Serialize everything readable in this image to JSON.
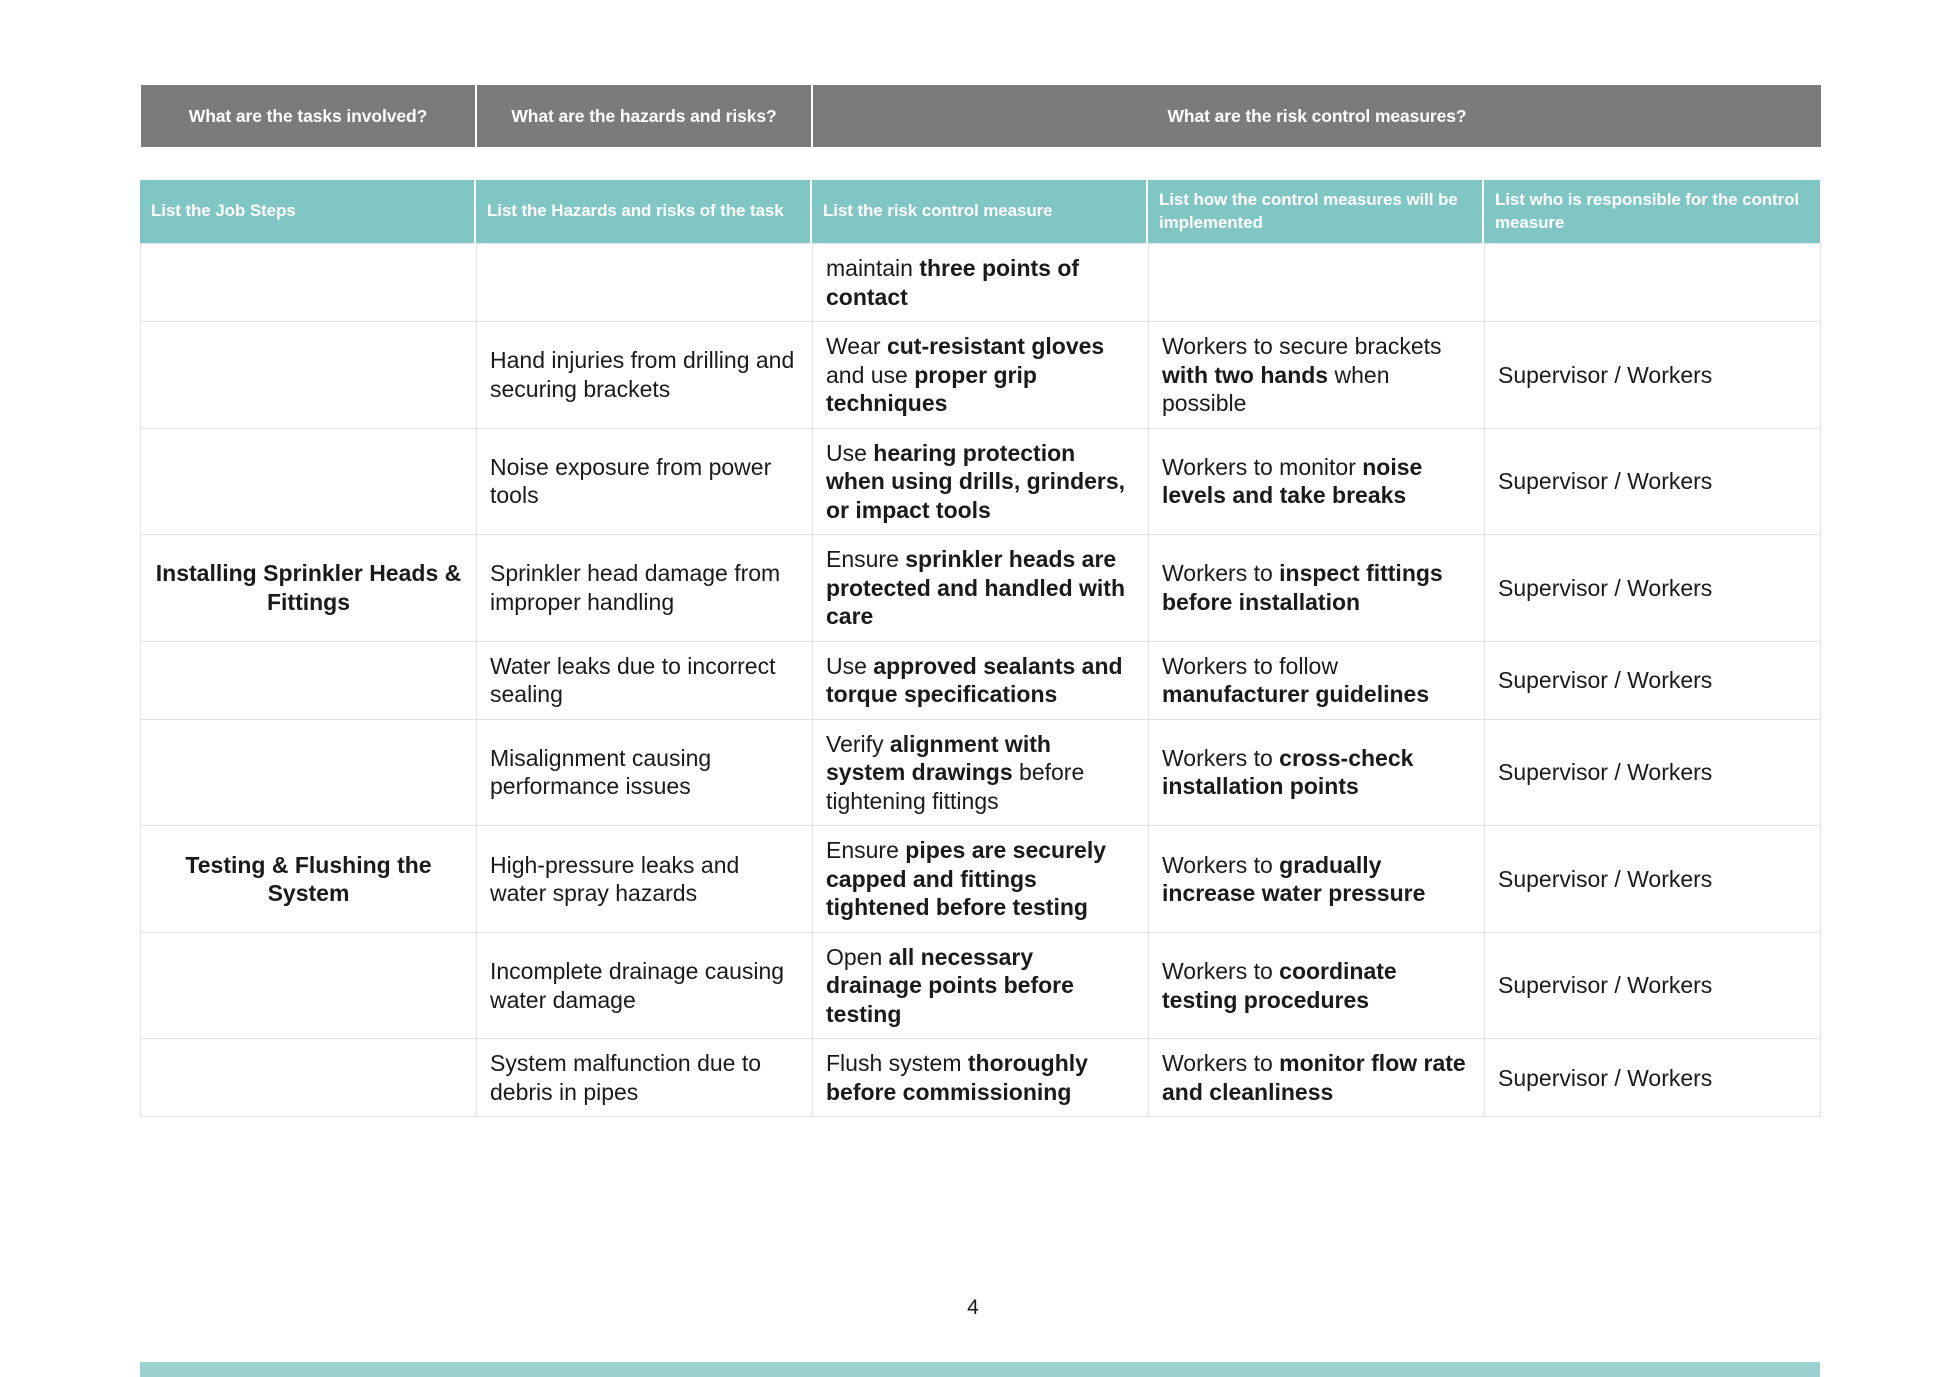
{
  "document": {
    "page_number": "4"
  },
  "top_header": {
    "tasks": "What are the tasks involved?",
    "hazards": "What are the hazards and risks?",
    "controls": "What are the risk control measures?"
  },
  "sub_header": {
    "col0": "List the Job Steps",
    "col1": "List the Hazards and risks of the task",
    "col2": "List the risk control measure",
    "col3": "List how the control measures will be implemented",
    "col4": "List who is responsible for the control measure"
  },
  "colors": {
    "top_header_bg": "#7b7b7b",
    "sub_header_bg": "#7fc6c4",
    "bottom_bar": "#9bd1d0",
    "grid_line": "#e2e2e2",
    "text": "#1a1a1a"
  },
  "rows": [
    {
      "step": "",
      "hazard": "",
      "control_runs": [
        {
          "text": "maintain ",
          "bold": false
        },
        {
          "text": "three points of contact",
          "bold": true
        }
      ],
      "implementation_runs": [],
      "responsible": ""
    },
    {
      "step": "",
      "hazard": "Hand injuries from drilling and securing brackets",
      "control_runs": [
        {
          "text": "Wear ",
          "bold": false
        },
        {
          "text": "cut-resistant gloves",
          "bold": true
        },
        {
          "text": " and use ",
          "bold": false
        },
        {
          "text": "proper grip techniques",
          "bold": true
        }
      ],
      "implementation_runs": [
        {
          "text": "Workers to secure brackets ",
          "bold": false
        },
        {
          "text": "with two hands",
          "bold": true
        },
        {
          "text": " when possible",
          "bold": false
        }
      ],
      "responsible": "Supervisor / Workers"
    },
    {
      "step": "",
      "hazard": "Noise exposure from power tools",
      "control_runs": [
        {
          "text": "Use ",
          "bold": false
        },
        {
          "text": "hearing protection when using drills, grinders, or impact tools",
          "bold": true
        }
      ],
      "implementation_runs": [
        {
          "text": "Workers to monitor ",
          "bold": false
        },
        {
          "text": "noise levels and take breaks",
          "bold": true
        }
      ],
      "responsible": "Supervisor / Workers"
    },
    {
      "step": "Installing Sprinkler Heads & Fittings",
      "hazard": "Sprinkler head damage from improper handling",
      "control_runs": [
        {
          "text": "Ensure ",
          "bold": false
        },
        {
          "text": "sprinkler heads are protected and handled with care",
          "bold": true
        }
      ],
      "implementation_runs": [
        {
          "text": "Workers to ",
          "bold": false
        },
        {
          "text": "inspect fittings before installation",
          "bold": true
        }
      ],
      "responsible": "Supervisor / Workers"
    },
    {
      "step": "",
      "hazard": "Water leaks due to incorrect sealing",
      "control_runs": [
        {
          "text": "Use ",
          "bold": false
        },
        {
          "text": "approved sealants and torque specifications",
          "bold": true
        }
      ],
      "implementation_runs": [
        {
          "text": "Workers to follow ",
          "bold": false
        },
        {
          "text": "manufacturer guidelines",
          "bold": true
        }
      ],
      "responsible": "Supervisor / Workers"
    },
    {
      "step": "",
      "hazard": "Misalignment causing performance issues",
      "control_runs": [
        {
          "text": "Verify ",
          "bold": false
        },
        {
          "text": "alignment with system drawings",
          "bold": true
        },
        {
          "text": " before tightening fittings",
          "bold": false
        }
      ],
      "implementation_runs": [
        {
          "text": "Workers to ",
          "bold": false
        },
        {
          "text": "cross-check installation points",
          "bold": true
        }
      ],
      "responsible": "Supervisor / Workers"
    },
    {
      "step": "Testing & Flushing the System",
      "hazard": "High-pressure leaks and water spray hazards",
      "control_runs": [
        {
          "text": "Ensure ",
          "bold": false
        },
        {
          "text": "pipes are securely capped and fittings tightened before testing",
          "bold": true
        }
      ],
      "implementation_runs": [
        {
          "text": "Workers to ",
          "bold": false
        },
        {
          "text": "gradually increase water pressure",
          "bold": true
        }
      ],
      "responsible": "Supervisor / Workers"
    },
    {
      "step": "",
      "hazard": "Incomplete drainage causing water damage",
      "control_runs": [
        {
          "text": "Open ",
          "bold": false
        },
        {
          "text": "all necessary drainage points before testing",
          "bold": true
        }
      ],
      "implementation_runs": [
        {
          "text": "Workers to ",
          "bold": false
        },
        {
          "text": "coordinate testing procedures",
          "bold": true
        }
      ],
      "responsible": "Supervisor / Workers"
    },
    {
      "step": "",
      "hazard": "System malfunction due to debris in pipes",
      "control_runs": [
        {
          "text": "Flush system ",
          "bold": false
        },
        {
          "text": "thoroughly before commissioning",
          "bold": true
        }
      ],
      "implementation_runs": [
        {
          "text": "Workers to ",
          "bold": false
        },
        {
          "text": "monitor flow rate and cleanliness",
          "bold": true
        }
      ],
      "responsible": "Supervisor / Workers"
    }
  ]
}
